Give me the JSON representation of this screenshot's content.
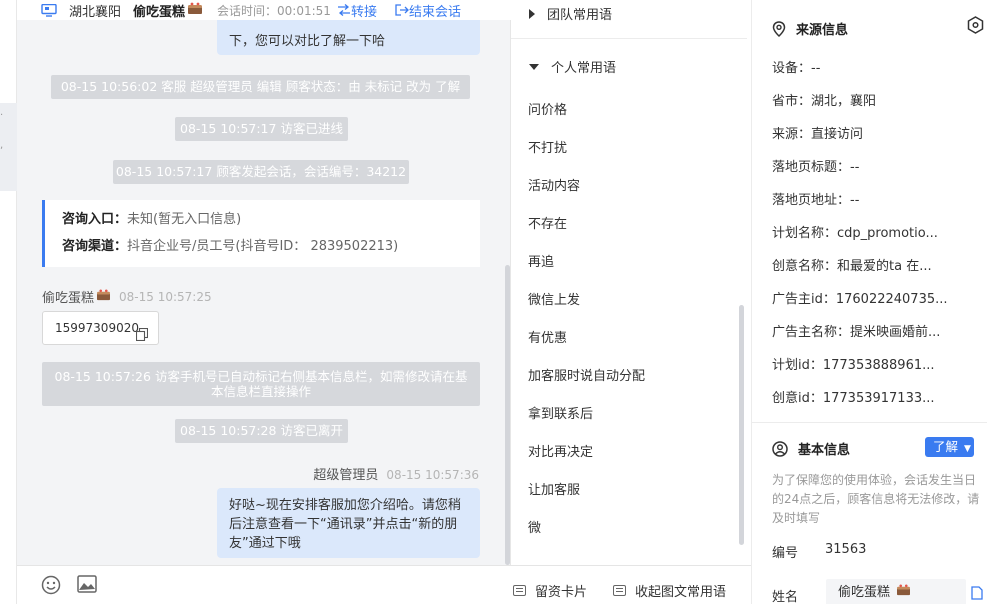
{
  "header": {
    "location": "湖北襄阳",
    "visitor_name": "偷吃蛋糕",
    "session_time": "会话时间：00:01:51",
    "transfer_label": "转接",
    "end_label": "结束会话"
  },
  "messages": {
    "prev_bubble_text": "下，您可以对比了解一下哈",
    "sys1": "08-15 10:56:02 客服 超级管理员 编辑 顾客状态：由 未标记 改为 了解",
    "sys2": "08-15 10:57:17 访客已进线",
    "sys3": "08-15 10:57:17 顾客发起会话，会话编号：34212",
    "card": {
      "entry_key": "咨询入口：",
      "entry_val": "未知(暂无入口信息)",
      "channel_key": "咨询渠道：",
      "channel_val": "抖音企业号/员工号(抖音号ID： 2839502213)"
    },
    "visitor_sender": "偷吃蛋糕",
    "visitor_time": "08-15 10:57:25",
    "visitor_phone": "15997309020",
    "sys4": "08-15 10:57:26 访客手机号已自动标记右侧基本信息栏，如需修改请在基本信息栏直接操作",
    "sys5": "08-15 10:57:28 访客已离开",
    "agent_sender": "超级管理员",
    "agent_time": "08-15 10:57:36",
    "agent_text": "好哒~现在安排客服加您介绍哈。请您稍后注意查看一下“通讯录”并点击“新的朋友”通过下哦"
  },
  "phrases": {
    "team_group": "团队常用语",
    "personal_group": "个人常用语",
    "items": [
      "问价格",
      "不打扰",
      "活动内容",
      "不存在",
      "再追",
      "微信上发",
      "有优惠",
      "加客服时说自动分配",
      "拿到联系后",
      "对比再决定",
      "让加客服",
      "微"
    ],
    "leave_card": "留资卡片",
    "collapse_label": "收起图文常用语"
  },
  "source": {
    "title": "来源信息",
    "fields": [
      "设备：--",
      "省市：湖北，襄阳",
      "来源：直接访问",
      "落地页标题：--",
      "落地页地址：--",
      "计划名称：cdp_promotio...",
      "创意名称：和最爱的ta 在...",
      "广告主id：176022240735...",
      "广告主名称：提米映画婚前...",
      "计划id：177353888961...",
      "创意id：177353917133..."
    ]
  },
  "basic": {
    "title": "基本信息",
    "know_btn": "了解",
    "hint": "为了保障您的使用体验，会话发生当日的24点之后，顾客信息将无法修改，请及时填写",
    "id_label": "编号",
    "id_value": "31563",
    "name_label": "姓名",
    "name_value": "偷吃蛋糕"
  },
  "colors": {
    "accent": "#3a7bf0",
    "bubble": "#dbe8fb",
    "system": "#d6d8dc"
  }
}
